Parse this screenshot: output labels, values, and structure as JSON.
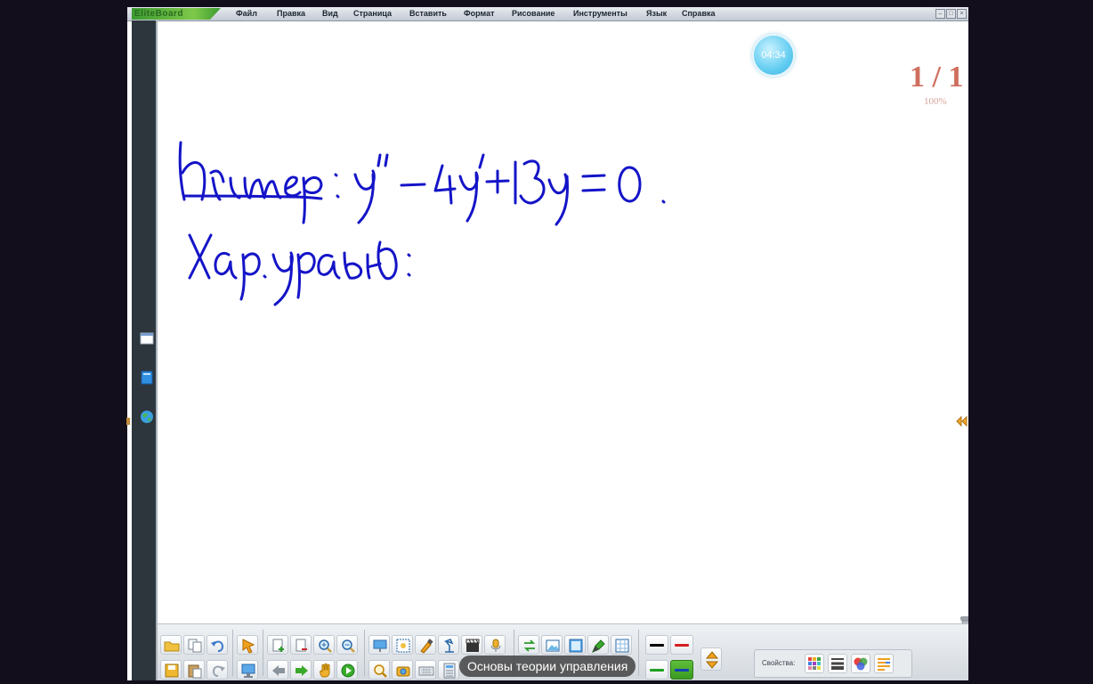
{
  "app": {
    "logo_text": "EliteBoard",
    "menu": [
      "Файл",
      "Правка",
      "Вид",
      "Страница",
      "Вставить",
      "Формат",
      "Рисование",
      "Инструменты",
      "Язык",
      "Справка"
    ],
    "window_buttons": [
      "minimize",
      "restore",
      "close"
    ]
  },
  "board": {
    "timer": "04:34",
    "page_counter": "1 / 1",
    "zoom": "100%",
    "handwriting": [
      "Пример: y'' − 4y' + 13y = 0.",
      "Хар. уравн.:"
    ],
    "ink_color": "#1414c8",
    "background_color": "#ffffff"
  },
  "sidebar": {
    "icons": [
      "window-icon",
      "book-icon",
      "globe-icon"
    ]
  },
  "toolbar": {
    "file_tools": [
      "open-folder-icon",
      "copy-icon",
      "undo-icon",
      "save-icon",
      "paste-icon",
      "redo-icon"
    ],
    "nav_tools": [
      "select-arrow-icon",
      "screen-icon"
    ],
    "page_tools": [
      "add-page-icon",
      "delete-page-icon",
      "zoom-in-icon",
      "zoom-out-icon",
      "prev-page-icon",
      "next-page-icon",
      "hand-icon",
      "play-icon"
    ],
    "insert_tools": [
      "screen-shade-icon",
      "spotlight-icon",
      "highlighter-icon",
      "lamp-icon",
      "film-icon",
      "microphone-icon",
      "magnifier-icon",
      "camera-icon",
      "keyboard-icon",
      "calculator-icon"
    ],
    "draw_tools": [
      "convert-icon",
      "picture-icon",
      "image-frame-icon",
      "pen-tool-icon",
      "grid-edit-icon"
    ],
    "pen_colors": [
      "#000000",
      "#d42020",
      "#20a020",
      "#1540b0"
    ],
    "active_pen_color": "#1540b0",
    "properties_label": "Свойства:",
    "properties_icons": [
      "palette-icon",
      "line-style-icon",
      "color-mix-icon",
      "align-icon"
    ]
  },
  "tooltip": "Основы теории управления"
}
